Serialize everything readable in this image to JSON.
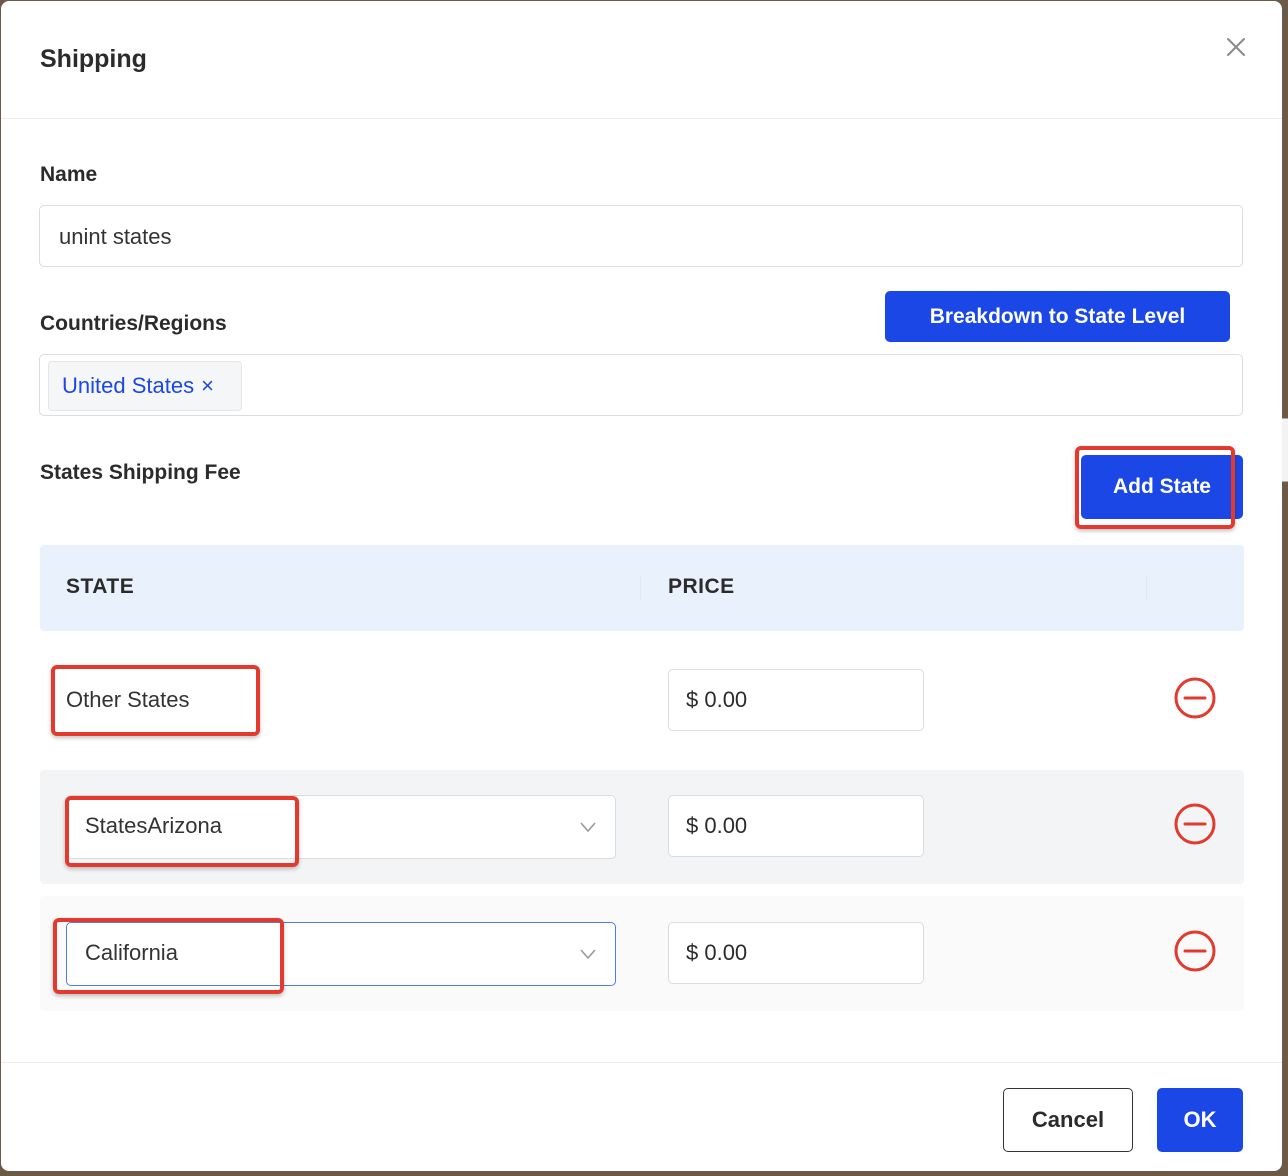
{
  "modal": {
    "title": "Shipping",
    "close_icon": "close-icon"
  },
  "name_field": {
    "label": "Name",
    "value": "unint states"
  },
  "regions": {
    "label": "Countries/Regions",
    "breakdown_button": "Breakdown to State Level",
    "tags": [
      "United States"
    ],
    "tag_remove_glyph": "×"
  },
  "states_fee": {
    "label": "States Shipping Fee",
    "add_button": "Add State"
  },
  "table": {
    "headers": [
      "STATE",
      "PRICE"
    ],
    "rows": [
      {
        "state": "Other States",
        "price": "$ 0.00",
        "editable": false
      },
      {
        "state": "StatesArizona",
        "price": "$ 0.00",
        "editable": true
      },
      {
        "state": "California",
        "price": "$ 0.00",
        "editable": true
      }
    ]
  },
  "footer": {
    "cancel": "Cancel",
    "ok": "OK"
  },
  "colors": {
    "primary": "#1b47e6",
    "danger": "#e23a2e",
    "table_header_bg": "#e9f1fc",
    "annotation": "#e23a2e"
  }
}
